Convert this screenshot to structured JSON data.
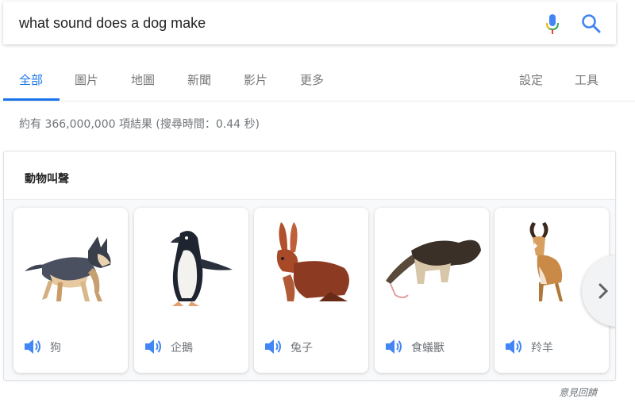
{
  "search": {
    "query": "what sound does a dog make"
  },
  "tabs": [
    {
      "label": "全部",
      "active": true
    },
    {
      "label": "圖片"
    },
    {
      "label": "地圖"
    },
    {
      "label": "新聞"
    },
    {
      "label": "影片"
    },
    {
      "label": "更多"
    }
  ],
  "tools": {
    "settings_label": "設定",
    "tools_label": "工具"
  },
  "result_stats": "約有 366,000,000 項結果 (搜尋時間：0.44 秒)",
  "panel": {
    "title": "動物叫聲",
    "animals": [
      {
        "name": "狗",
        "icon": "dog-illustration"
      },
      {
        "name": "企鵝",
        "icon": "penguin-illustration"
      },
      {
        "name": "兔子",
        "icon": "rabbit-illustration"
      },
      {
        "name": "食蟻獸",
        "icon": "anteater-illustration"
      },
      {
        "name": "羚羊",
        "icon": "antelope-illustration"
      }
    ]
  },
  "feedback_label": "意見回饋",
  "colors": {
    "accent": "#1a73e8",
    "speaker": "#4285f4",
    "muted_text": "#70757a"
  }
}
